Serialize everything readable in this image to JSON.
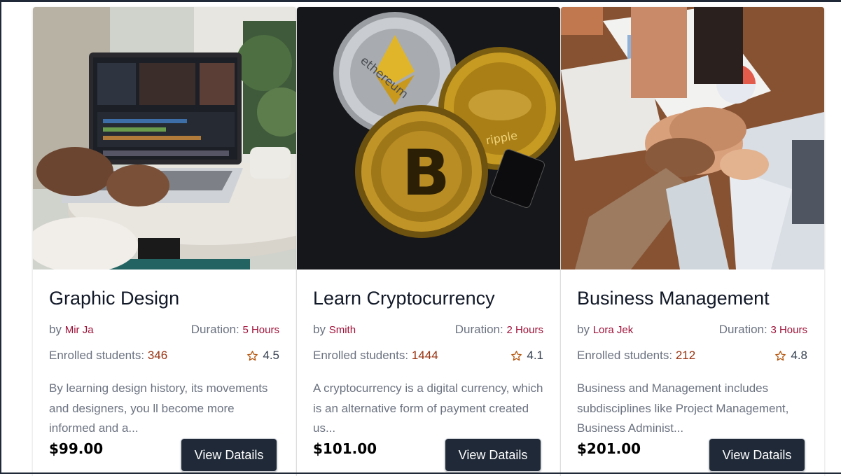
{
  "courses": [
    {
      "title": "Graphic Design",
      "by_label": "by",
      "author": "Mir Ja",
      "duration_label": "Duration:",
      "duration": "5 Hours",
      "enrolled_label": "Enrolled students:",
      "enrolled": "346",
      "rating": "4.5",
      "description": "By learning design history, its movements and designers, you ll become more informed and a...",
      "price": "$99.00",
      "button_label": "View Datails",
      "image": "laptop-on-cafe-table-photo"
    },
    {
      "title": "Learn Cryptocurrency",
      "by_label": "by",
      "author": "Smith",
      "duration_label": "Duration:",
      "duration": "2 Hours",
      "enrolled_label": "Enrolled students:",
      "enrolled": "1444",
      "rating": "4.1",
      "description": "A cryptocurrency is a digital currency, which is an alternative form of payment created us...",
      "price": "$101.00",
      "button_label": "View Datails",
      "image": "crypto-coins-photo",
      "image_text": [
        "ethereum",
        "ripple"
      ]
    },
    {
      "title": "Business Management",
      "by_label": "by",
      "author": "Lora Jek",
      "duration_label": "Duration:",
      "duration": "3 Hours",
      "enrolled_label": "Enrolled students:",
      "enrolled": "212",
      "rating": "4.8",
      "description": "Business and Management includes subdisciplines like Project Management, Business Administ...",
      "price": "$201.00",
      "button_label": "View Datails",
      "image": "team-hands-stacked-photo"
    }
  ],
  "colors": {
    "accent_author": "#9f1239",
    "accent_count": "#9a3412",
    "button_bg": "#1f2937",
    "star": "#b45309"
  },
  "icons": {
    "rating": "star-outline-icon"
  }
}
